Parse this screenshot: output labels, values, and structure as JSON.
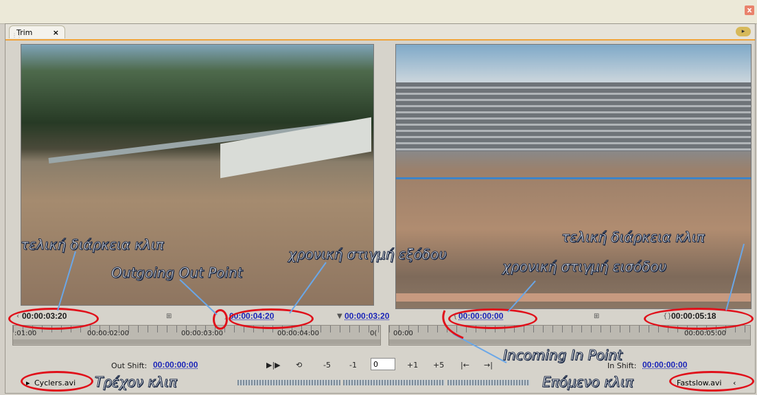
{
  "window": {
    "close_label": "x"
  },
  "tab": {
    "label": "Trim",
    "close_label": "×"
  },
  "left_monitor": {
    "duration": "00:00:03:20",
    "out_point": "00:00:04:20",
    "clip_name": "Cyclers.avi",
    "out_shift_label": "Out Shift:",
    "out_shift_value": "00:00:00:00",
    "ruler_labels": [
      ":01:00",
      "00:00:02:00",
      "00:00:03:00",
      "00:00:04:00",
      "0("
    ]
  },
  "right_monitor": {
    "in_point_left": "00:00:03:20",
    "in_point": "00:00:00:00",
    "duration": "00:00:05:18",
    "clip_name": "Fastslow.avi",
    "in_shift_label": "In Shift:",
    "in_shift_value": "00:00:00:00",
    "ruler_labels": [
      "00:00",
      "00:00:05:00"
    ]
  },
  "controls": {
    "minus5": "-5",
    "minus1": "-1",
    "offset_value": "0",
    "plus1": "+1",
    "plus5": "+5"
  },
  "annotations": {
    "left_duration": "τελική διάρκεια κλιπ",
    "outgoing": "Outgoing Out Point",
    "exit_time": "χρονική στιγμή εξόδου",
    "right_duration": "τελική διάρκεια κλιπ",
    "entry_time": "χρονική στιγμή εισόδου",
    "incoming": "Incoming In Point",
    "current_clip": "Τρέχον κλιπ",
    "next_clip": "Επόμενο κλιπ"
  },
  "colors": {
    "accent": "#f0a33a",
    "timecode_blue": "#1a24b8",
    "annotation_red": "#e0101a",
    "arrow_blue": "#6aa7e8"
  }
}
